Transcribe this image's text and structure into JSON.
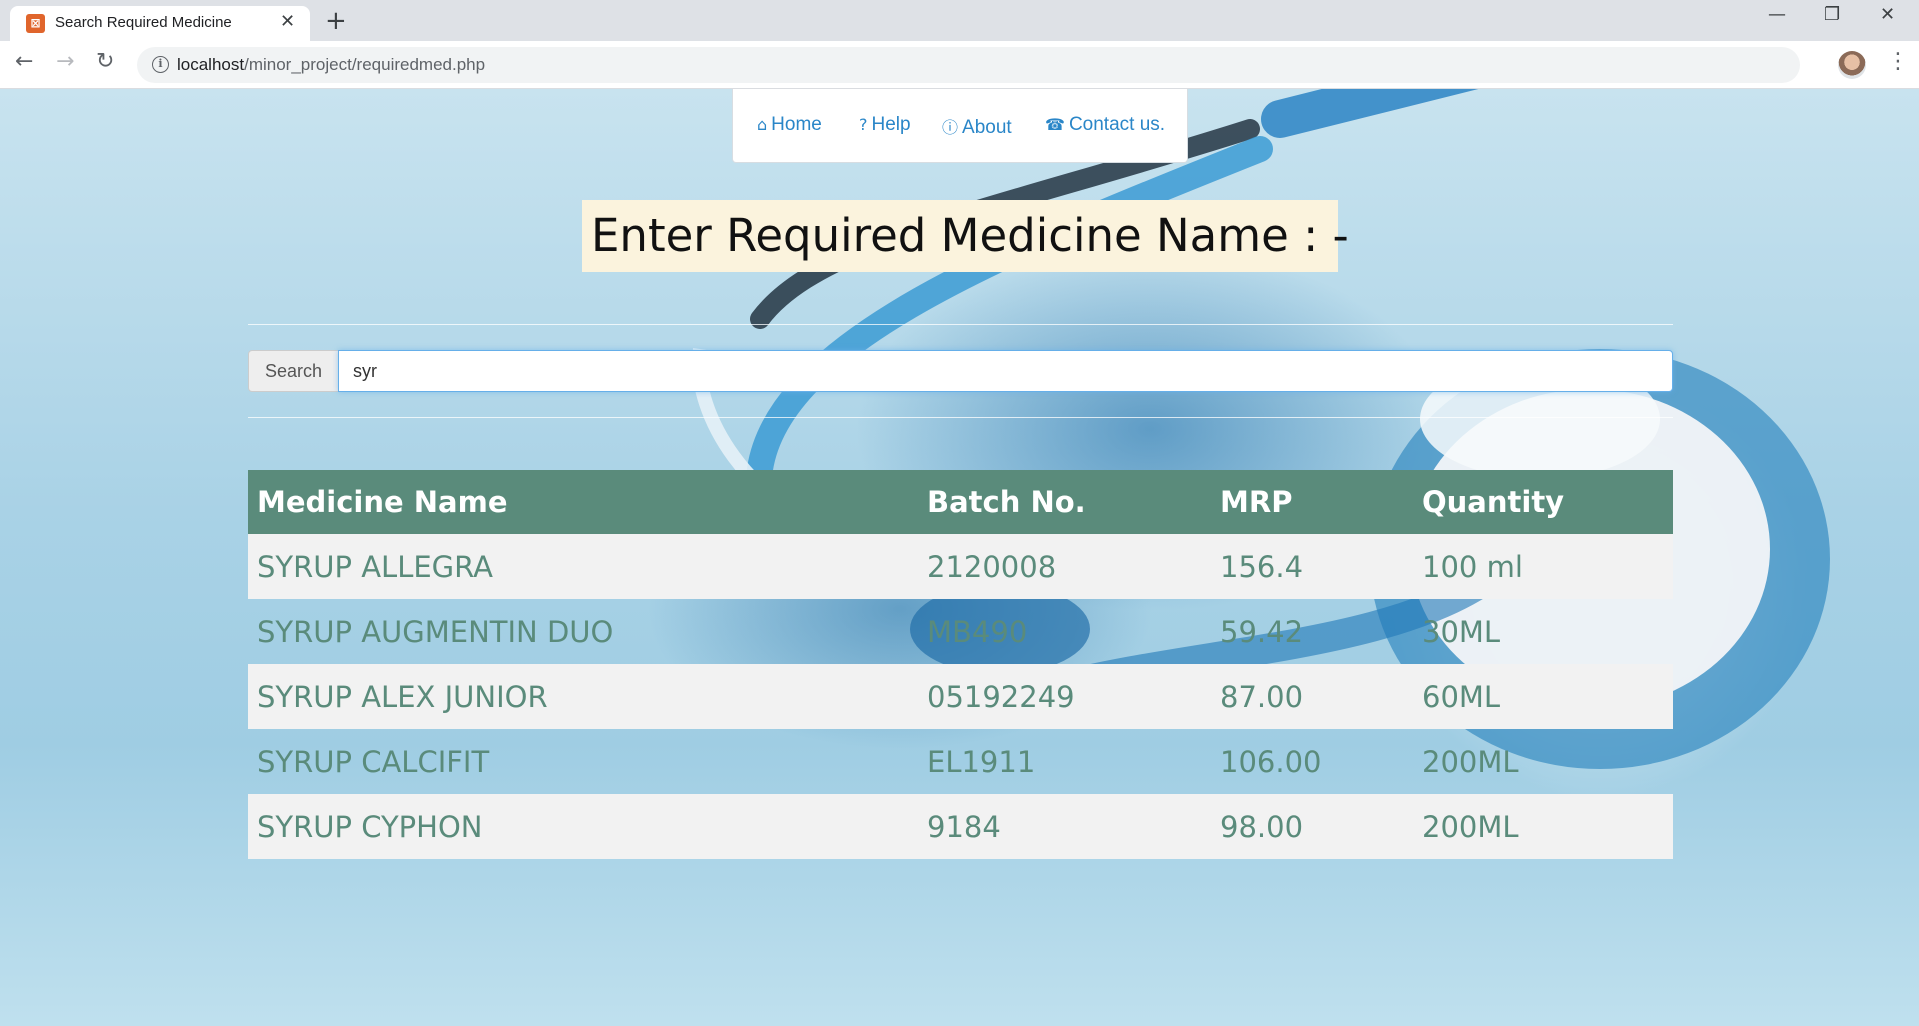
{
  "browser": {
    "tab_title": "Search Required Medicine",
    "url_host": "localhost",
    "url_path": "/minor_project/requiredmed.php"
  },
  "nav": {
    "home": "Home",
    "help": "Help",
    "about": "About",
    "contact": "Contact us."
  },
  "heading": "Enter Required Medicine Name : -",
  "search": {
    "label": "Search",
    "value": "syr"
  },
  "table": {
    "headers": [
      "Medicine Name",
      "Batch No.",
      "MRP",
      "Quantity"
    ],
    "rows": [
      [
        "SYRUP ALLEGRA",
        "2120008",
        "156.4",
        "100 ml"
      ],
      [
        "SYRUP AUGMENTIN DUO",
        "MB490",
        "59.42",
        "30ML"
      ],
      [
        "SYRUP ALEX JUNIOR",
        "05192249",
        "87.00",
        "60ML"
      ],
      [
        "SYRUP CALCIFIT",
        "EL1911",
        "106.00",
        "200ML"
      ],
      [
        "SYRUP CYPHON",
        "9184",
        "98.00",
        "200ML"
      ]
    ]
  },
  "colors": {
    "table_header": "#5a8b7b",
    "table_text": "#5a8b7b",
    "nav_link": "#2a86c8",
    "heading_bg": "#fbf3dd"
  }
}
